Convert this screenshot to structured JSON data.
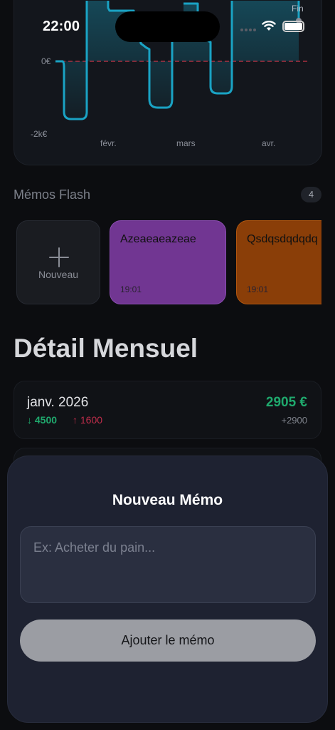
{
  "status_bar": {
    "time": "22:00"
  },
  "chart": {
    "fin_label": "Fin",
    "y_ticks": [
      "0€",
      "-2k€"
    ],
    "x_ticks": [
      "févr.",
      "mars",
      "avr."
    ],
    "line_color": "#1aa3c4",
    "zero_line_color": "#c43446"
  },
  "memos": {
    "section_title": "Mémos Flash",
    "count": "4",
    "new_label": "Nouveau",
    "items": [
      {
        "title": "Azeaeaeazeae",
        "time": "19:01",
        "color": "#713692"
      },
      {
        "title": "Qsdqsdqdqdq",
        "time": "19:01",
        "color": "#8a3e08"
      }
    ]
  },
  "monthly": {
    "title": "Détail Mensuel",
    "months": [
      {
        "name": "janv. 2026",
        "income": "↓ 4500",
        "expense": "↑ 1600",
        "total": "2905 €",
        "delta": "+2900"
      }
    ]
  },
  "sheet": {
    "title": "Nouveau Mémo",
    "input_placeholder": "Ex: Acheter du pain...",
    "input_value": "",
    "button_label": "Ajouter le mémo"
  }
}
